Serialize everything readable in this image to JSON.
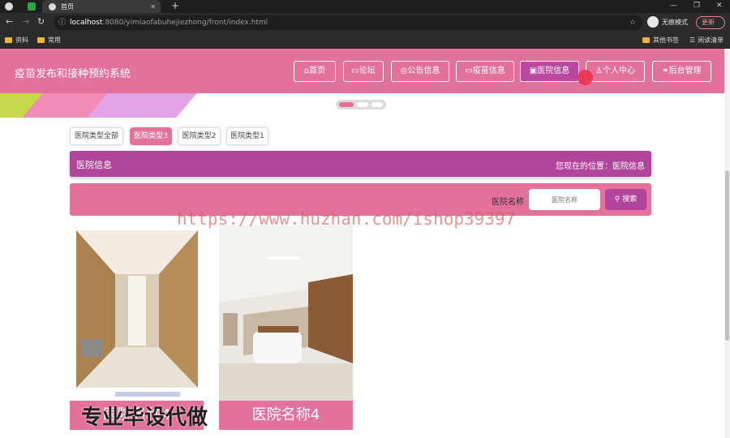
{
  "browser": {
    "tab_title": "首页",
    "url_host": "localhost",
    "url_path": ":8080/yimiaofabuhejiezhong/front/index.html",
    "incognito_label": "无痕模式",
    "update_label": "更新",
    "bookmarks": [
      "资料",
      "常用"
    ],
    "bookmarks_right": [
      "其他书签",
      "阅读清单"
    ]
  },
  "header": {
    "site_title": "疫苗发布和接种预约系统",
    "nav": [
      {
        "label": "首页",
        "icon": "home-icon"
      },
      {
        "label": "论坛",
        "icon": "forum-icon"
      },
      {
        "label": "公告信息",
        "icon": "notice-icon"
      },
      {
        "label": "疫苗信息",
        "icon": "vaccine-icon"
      },
      {
        "label": "医院信息",
        "icon": "hospital-icon",
        "active": true
      },
      {
        "label": "个人中心",
        "icon": "user-icon"
      },
      {
        "label": "后台管理",
        "icon": "link-icon"
      }
    ]
  },
  "filters": [
    "医院类型全部",
    "医院类型3",
    "医院类型2",
    "医院类型1"
  ],
  "filter_active_index": 1,
  "breadcrumb": {
    "title": "医院信息",
    "location": "您现在的位置：医院信息"
  },
  "search": {
    "label": "医院名称",
    "placeholder": "医院名称",
    "button": "搜索"
  },
  "cards": [
    {
      "name": "医院名称4"
    },
    {
      "name": "医院名称4"
    }
  ],
  "overlay": {
    "watermark_url": "https://www.huzhan.com/ishop39397",
    "watermark_text": "专业毕设代做"
  },
  "colors": {
    "brand_pink": "#e2729c",
    "brand_purple": "#b1459b"
  }
}
